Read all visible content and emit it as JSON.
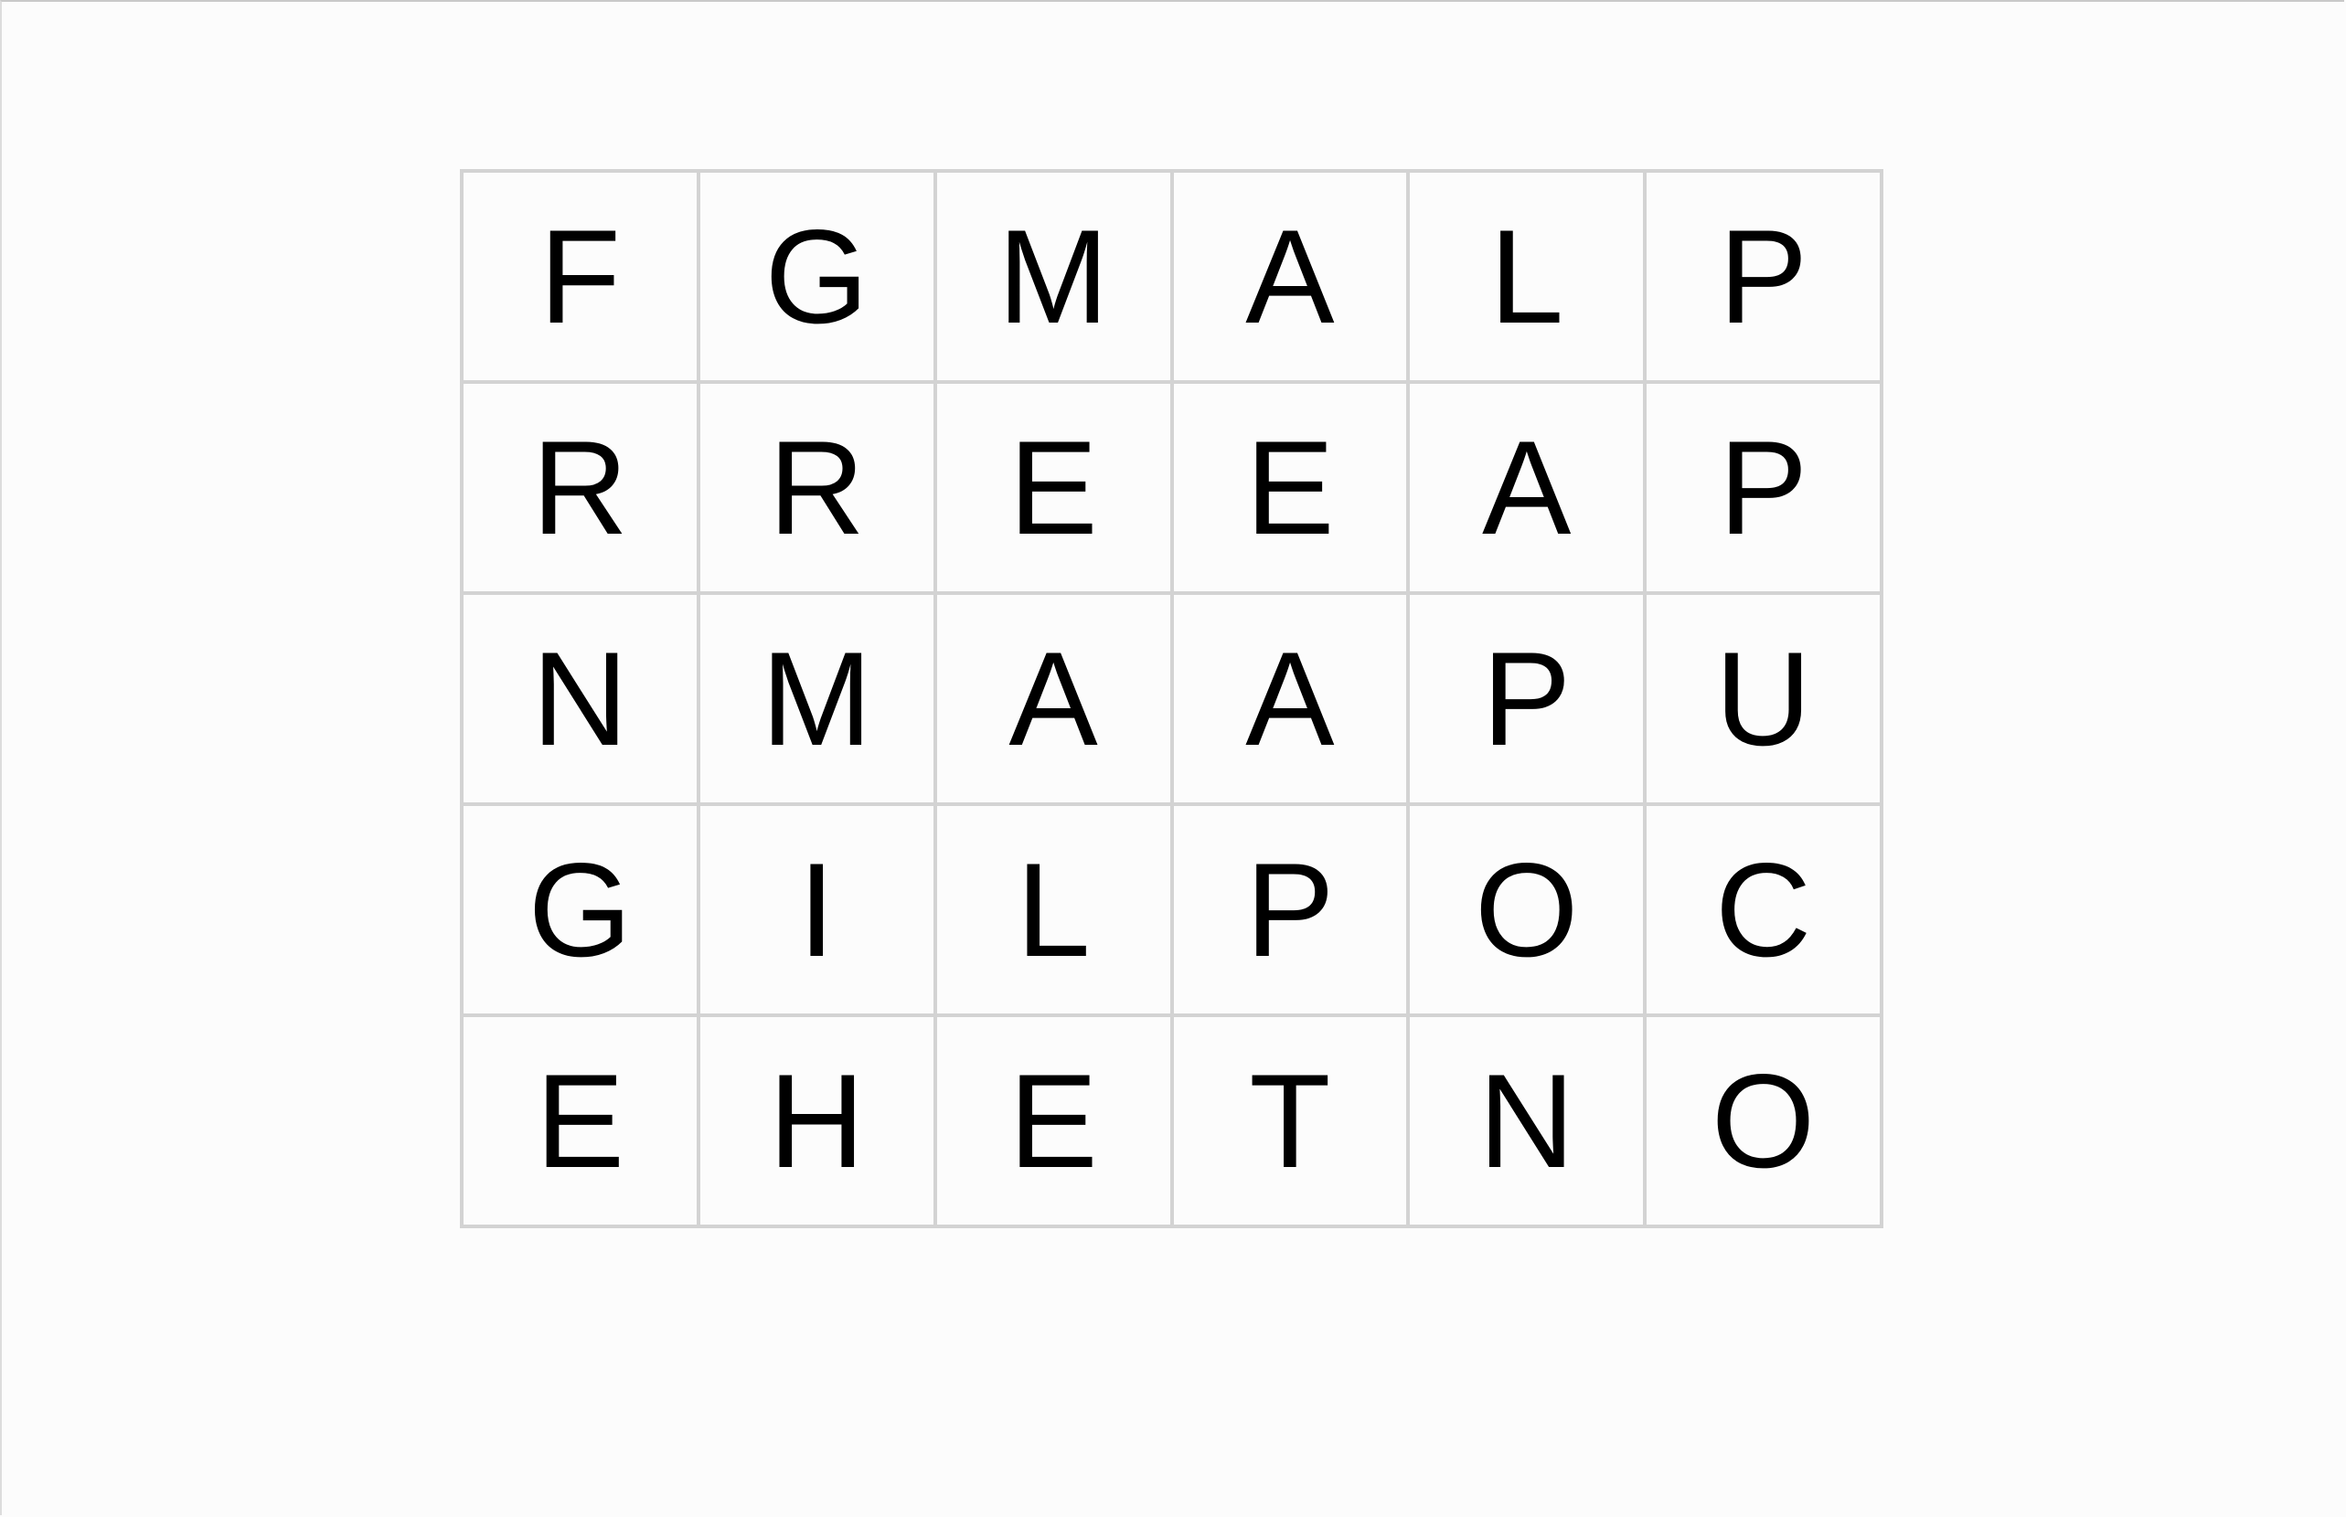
{
  "puzzle": {
    "rows": [
      [
        "F",
        "G",
        "M",
        "A",
        "L",
        "P"
      ],
      [
        "R",
        "R",
        "E",
        "E",
        "A",
        "P"
      ],
      [
        "N",
        "M",
        "A",
        "A",
        "P",
        "U"
      ],
      [
        "G",
        "I",
        "L",
        "P",
        "O",
        "C"
      ],
      [
        "E",
        "H",
        "E",
        "T",
        "N",
        "O"
      ]
    ]
  },
  "colors": {
    "background": "#fcfcfc",
    "grid_line": "#d3d3d3",
    "letter": "#000000"
  }
}
